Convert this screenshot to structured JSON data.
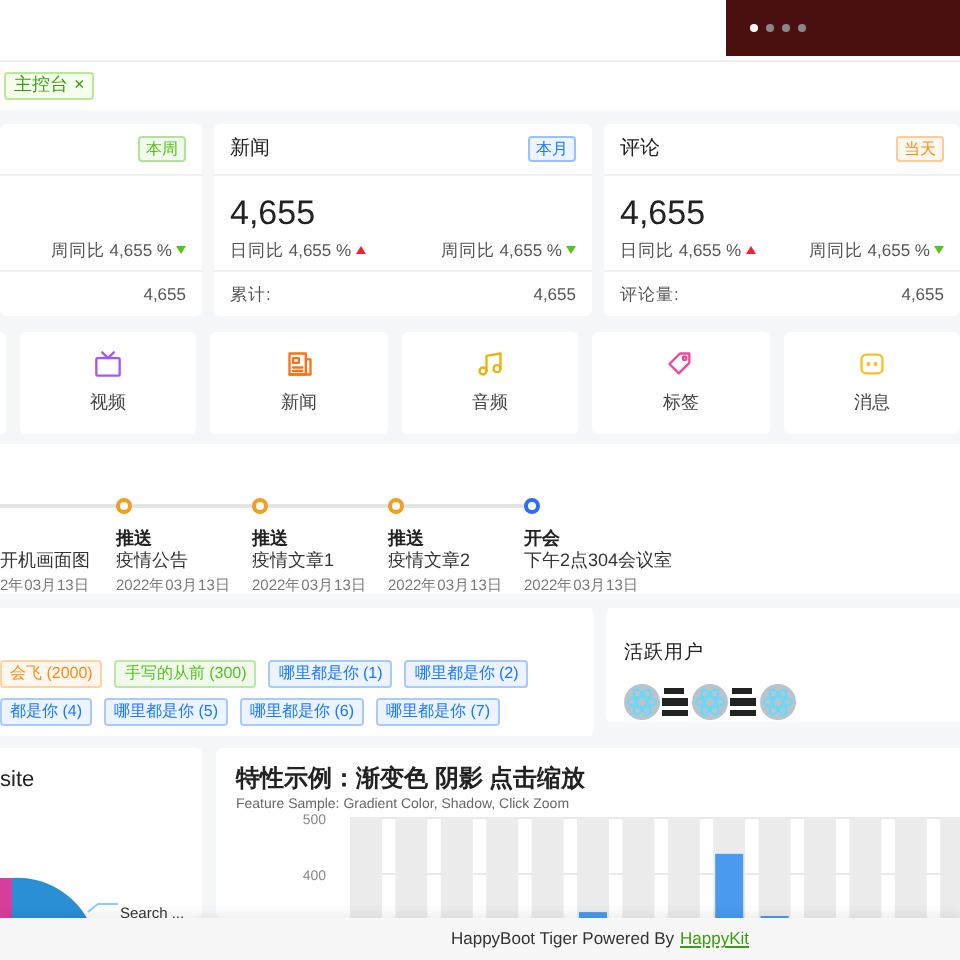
{
  "carousel": {
    "dots": [
      {
        "selected": true
      },
      {
        "selected": false
      },
      {
        "selected": false
      },
      {
        "selected": false
      }
    ]
  },
  "open_tabs": [
    {
      "label": "主控台",
      "close": "×",
      "selected": true
    }
  ],
  "stat_cards": [
    {
      "badge": "本周",
      "color": "#52c41a",
      "compare": [
        {
          "label": "周同比 4,655 %",
          "rising": false
        }
      ],
      "footer": {
        "value": "4,655"
      }
    },
    {
      "title": "新闻",
      "badge": "本月",
      "color": "#1677ff",
      "number": "4,655",
      "compare": [
        {
          "label": "日同比 4,655 %",
          "rising": true
        },
        {
          "label": "周同比 4,655 %",
          "rising": false
        }
      ],
      "footer": {
        "label": "累计:",
        "value": "4,655"
      }
    },
    {
      "title": "评论",
      "badge": "当天",
      "color": "#fa8c16",
      "number": "4,655",
      "compare": [
        {
          "label": "日同比 4,655 %",
          "rising": true
        },
        {
          "label": "周同比 4,655 %",
          "rising": false
        }
      ],
      "footer": {
        "label": "评论量:",
        "value": "4,655"
      }
    }
  ],
  "shortcuts": [
    {
      "label": "视频",
      "kind": "tv",
      "color": "#a855f7"
    },
    {
      "label": "新闻",
      "kind": "news",
      "color": "#f97316"
    },
    {
      "label": "音频",
      "kind": "music",
      "color": "#eab308"
    },
    {
      "label": "标签",
      "kind": "tag",
      "color": "#ec4899"
    },
    {
      "label": "消息",
      "kind": "message",
      "color": "#fbbf24"
    }
  ],
  "timeline": [
    {
      "content": "开机画面图",
      "date": "2年03月13日"
    },
    {
      "title": "推送",
      "content": "疫情公告",
      "date": "2022年03月13日",
      "color": "#f0a020"
    },
    {
      "title": "推送",
      "content": "疫情文章1",
      "date": "2022年03月13日",
      "color": "#f0a020"
    },
    {
      "title": "推送",
      "content": "疫情文章2",
      "date": "2022年03月13日",
      "color": "#f0a020"
    },
    {
      "title": "开会",
      "content": "下午2点304会议室",
      "date": "2022年03月13日",
      "color": "#2f6bff"
    }
  ],
  "tag_cloud": [
    [
      {
        "label": "会飞 (2000)",
        "color": "#fa8c16"
      },
      {
        "label": "手写的从前 (300)",
        "color": "#52c41a"
      },
      {
        "label": "哪里都是你 (1)",
        "color": "#1677ff"
      },
      {
        "label": "哪里都是你 (2)",
        "color": "#1677ff"
      }
    ],
    [
      {
        "label": "都是你 (4)",
        "color": "#1677ff"
      },
      {
        "label": "哪里都是你 (5)",
        "color": "#1677ff"
      },
      {
        "label": "哪里都是你 (6)",
        "color": "#1677ff"
      },
      {
        "label": "哪里都是你 (7)",
        "color": "#1677ff"
      }
    ]
  ],
  "active_users": {
    "title": "活跃用户",
    "avatars": [
      {
        "kind": "logo"
      },
      {
        "kind": "text"
      },
      {
        "kind": "logo"
      },
      {
        "kind": "text"
      },
      {
        "kind": "logo"
      }
    ]
  },
  "source_card": {
    "title": "site",
    "pie_label": "Search ..."
  },
  "feature_card": {
    "title": "特性示例：渐变色 阴影 点击缩放",
    "subtitle": "Feature Sample: Gradient Color, Shadow, Click Zoom",
    "chart_data": {
      "type": "bar",
      "yticks": [
        400,
        500
      ],
      "ylim": [
        0,
        500
      ],
      "series": [
        {
          "color": "#ececec",
          "values": [
            500,
            500,
            500,
            500,
            500,
            500,
            500,
            500,
            500,
            500,
            500,
            500,
            500,
            500
          ]
        },
        {
          "color": "#4a9af0",
          "values": [
            null,
            null,
            null,
            null,
            null,
            332,
            null,
            null,
            436,
            325,
            null,
            null,
            null,
            null
          ]
        }
      ]
    }
  },
  "footer": {
    "text": "HappyBoot Tiger Powered By",
    "link": "HappyKit"
  }
}
